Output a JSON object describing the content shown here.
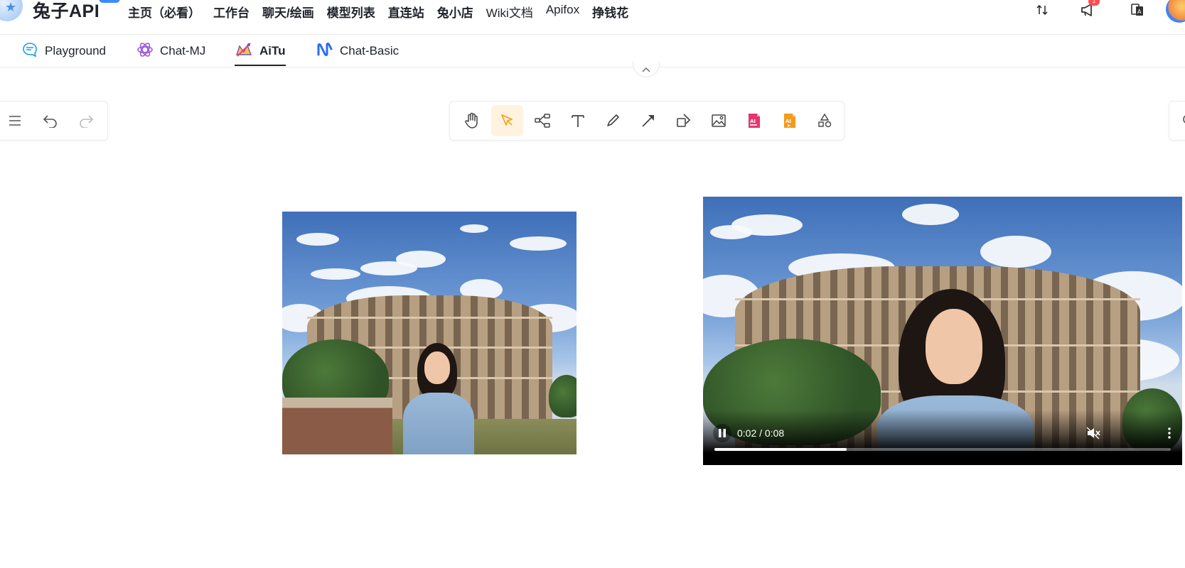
{
  "header": {
    "brand": "兔子API",
    "nav": [
      {
        "label": "主页（必看）"
      },
      {
        "label": "工作台"
      },
      {
        "label": "聊天/绘画"
      },
      {
        "label": "模型列表"
      },
      {
        "label": "直连站"
      },
      {
        "label": "兔小店"
      },
      {
        "label": "Wiki文档"
      },
      {
        "label": "Apifox"
      },
      {
        "label": "挣钱花"
      }
    ],
    "icons": [
      "sort-icon",
      "megaphone-icon",
      "translate-icon"
    ],
    "notification_badge": "1"
  },
  "tabs": [
    {
      "label": "Playground",
      "icon": "chat-bubble-icon",
      "active": false
    },
    {
      "label": "Chat-MJ",
      "icon": "openai-logo-icon",
      "active": false
    },
    {
      "label": "AiTu",
      "icon": "aitu-logo-icon",
      "active": true
    },
    {
      "label": "Chat-Basic",
      "icon": "chat-basic-logo-icon",
      "active": false
    }
  ],
  "toolbar": {
    "left": [
      "menu-icon",
      "undo-icon",
      "redo-icon"
    ],
    "tools": [
      {
        "name": "hand-tool",
        "icon": "hand-icon",
        "active": false
      },
      {
        "name": "select-tool",
        "icon": "pointer-icon",
        "active": true
      },
      {
        "name": "mindmap-tool",
        "icon": "mindmap-icon",
        "active": false
      },
      {
        "name": "text-tool",
        "icon": "text-icon",
        "active": false
      },
      {
        "name": "pen-tool",
        "icon": "pencil-icon",
        "active": false
      },
      {
        "name": "arrow-tool",
        "icon": "arrow-icon",
        "active": false
      },
      {
        "name": "shape-tool",
        "icon": "shapes-icon",
        "active": false
      },
      {
        "name": "image-tool",
        "icon": "image-icon",
        "active": false
      },
      {
        "name": "ai-image-tool",
        "icon": "ai-image-icon",
        "active": false
      },
      {
        "name": "ai-video-tool",
        "icon": "ai-video-icon",
        "active": false
      },
      {
        "name": "more-tools",
        "icon": "extra-shapes-icon",
        "active": false
      }
    ],
    "accent": "#f5a623"
  },
  "video": {
    "current_time": "0:02",
    "duration": "0:08",
    "time_display": "0:02 / 0:08",
    "progress": 0.29,
    "muted": true,
    "playing": true
  },
  "colors": {
    "notification": "#ff4d4f",
    "brand_badge": "#3b8cff",
    "tool_active_bg": "#fff3e0"
  }
}
